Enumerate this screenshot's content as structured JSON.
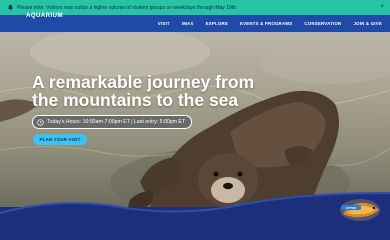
{
  "alert": {
    "icon": "bell-icon",
    "text": "Please note: Visitors may notice a higher volume of student groups on weekdays through May 19th.",
    "close_label": "×"
  },
  "header": {
    "logo_text": "AQUARIUM",
    "nav": [
      "VISIT",
      "IMAX",
      "EXPLORE",
      "EVENTS & PROGRAMS",
      "CONSERVATION",
      "JOIN & GIVE"
    ]
  },
  "hero": {
    "title": "A remarkable journey from the mountains to the sea",
    "hours": "Today's Hours: 10:00am-7:00pm ET | Last entry: 5:00pm ET",
    "cta_label": "PLAN YOUR VISIT",
    "badge_icon": "otter-badge-icon"
  },
  "colors": {
    "alert_bg": "#27c4a3",
    "header_bg": "#1f4aa8",
    "wave_bg": "#1d2f7a",
    "cta_bg": "#3ec3ef"
  }
}
